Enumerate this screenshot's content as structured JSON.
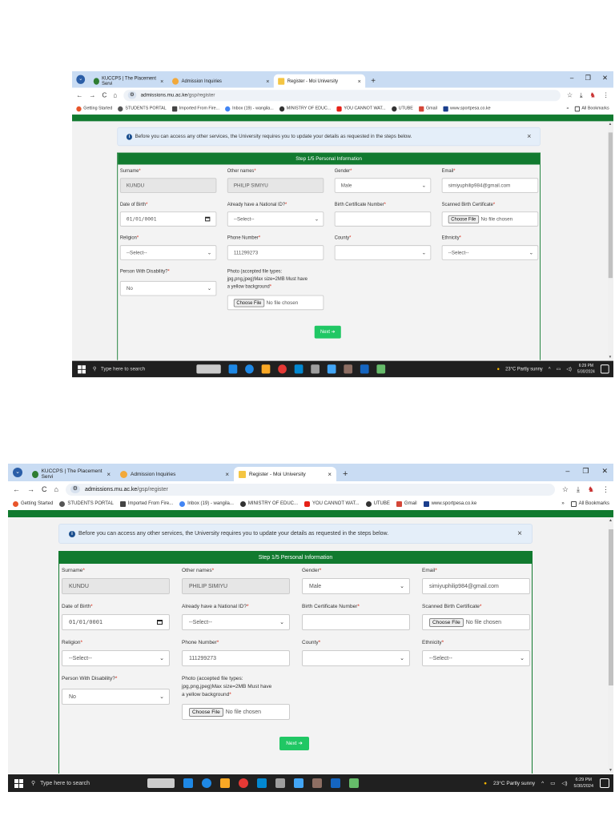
{
  "browser": {
    "tabs": [
      {
        "label": "KUCCPS | The Placement Servi",
        "active": false,
        "icon_color": "#2e7d32"
      },
      {
        "label": "Admission Inquiries",
        "active": false,
        "icon_color": "#f2a93b"
      },
      {
        "label": "Register - Moi University",
        "active": true,
        "icon_color": "#f4c542"
      }
    ],
    "new_tab": "+",
    "window_controls": [
      "–",
      "❐",
      "✕"
    ],
    "nav": {
      "back": "←",
      "forward": "→",
      "reload": "C",
      "home": "⌂"
    },
    "url_host": "admissions.mu.ac.ke",
    "url_path": "/gsp/register",
    "toolbar_right": [
      "☆",
      "⤓",
      "⋮"
    ],
    "bookmarks": [
      {
        "label": "Getting Started",
        "color": "#e8552b"
      },
      {
        "label": "STUDENTS PORTAL",
        "color": "#555555"
      },
      {
        "label": "Imported From Fire...",
        "color": "#444444"
      },
      {
        "label": "Inbox (19) - wangila...",
        "color": "#4285f4"
      },
      {
        "label": "MINISTRY OF EDUC...",
        "color": "#333333"
      },
      {
        "label": "YOU CANNOT WAT...",
        "color": "#e62117"
      },
      {
        "label": "UTUBE",
        "color": "#333333"
      },
      {
        "label": "Gmail",
        "color": "#d44638"
      },
      {
        "label": "www.sportpesa.co.ke",
        "color": "#1a3e8c"
      }
    ],
    "bookmarks_more": "»",
    "all_bookmarks": "All Bookmarks"
  },
  "alert": {
    "text": "Before you can access any other services, the University requires you to update your details as requested in the steps below.",
    "close": "×"
  },
  "form": {
    "step_title": "Step 1/5 Personal Information",
    "surname": {
      "label": "Surname",
      "value": "KUNDU"
    },
    "other_names": {
      "label": "Other names",
      "value": "PHILIP SIMIYU"
    },
    "gender": {
      "label": "Gender",
      "value": "Male"
    },
    "email": {
      "label": "Email",
      "value": "simiyuphilip984@gmail.com"
    },
    "dob": {
      "label": "Date of Birth",
      "value": "01/01/0001"
    },
    "national_id": {
      "label": "Already have a National ID?",
      "value": "--Select--"
    },
    "birth_cert_no": {
      "label": "Birth Certificate Number",
      "value": ""
    },
    "scanned_birth_cert": {
      "label": "Scanned Birth Certificate",
      "button": "Choose File",
      "status": "No file chosen"
    },
    "religion": {
      "label": "Religion",
      "value": "--Select--"
    },
    "phone": {
      "label": "Phone Number",
      "value": "111299273"
    },
    "county": {
      "label": "County",
      "value": ""
    },
    "ethnicity": {
      "label": "Ethnicity",
      "value": "--Select--"
    },
    "disability": {
      "label": "Person With Disability?",
      "value": "No"
    },
    "photo": {
      "label_lines": [
        "Photo (accepted file types:",
        "jpg,png,jpeg)Max size=2MB Must have",
        "a yellow background"
      ],
      "button": "Choose File",
      "status": "No file chosen"
    },
    "next_button": "Next ➔",
    "required_mark": "*"
  },
  "taskbar": {
    "search_placeholder": "Type here to search",
    "weather": "23°C  Partly sunny",
    "time": "6:29 PM",
    "date": "5/30/2024",
    "app_icon_colors": [
      "#cccccc",
      "#1e88e5",
      "#f9a825",
      "#e53935",
      "#0288d1",
      "#9e9e9e",
      "#42a5f5",
      "#8d6e63",
      "#1565c0",
      "#66bb6a"
    ]
  }
}
